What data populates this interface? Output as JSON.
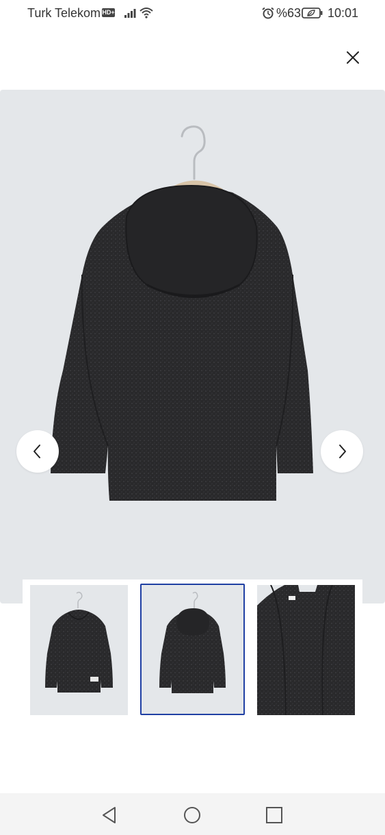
{
  "status_bar": {
    "carrier": "Turk Telekom",
    "network_badge": "HD+",
    "battery_percent": "%63",
    "time": "10:01",
    "icons": [
      "signal-icon",
      "wifi-icon",
      "alarm-icon",
      "battery-leaf-icon"
    ]
  },
  "gallery": {
    "close_icon": "close-icon",
    "prev_icon": "chevron-left-icon",
    "next_icon": "chevron-right-icon",
    "selected_thumbnail": 2,
    "thumbnail_count": 3,
    "colors": {
      "background": "#e4e7ea",
      "garment": "#2a2a2c",
      "selected_border": "#1f3fa3"
    }
  },
  "system_nav": {
    "icons": [
      "back-triangle-icon",
      "home-circle-icon",
      "recent-square-icon"
    ]
  }
}
